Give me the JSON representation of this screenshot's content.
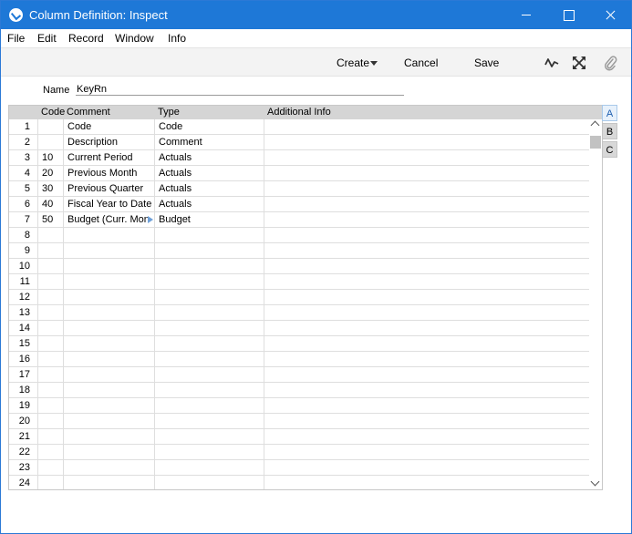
{
  "window": {
    "title": "Column Definition: Inspect"
  },
  "menu": [
    "File",
    "Edit",
    "Record",
    "Window",
    "Info"
  ],
  "toolbar": {
    "create": "Create",
    "cancel": "Cancel",
    "save": "Save"
  },
  "form": {
    "name_label": "Name",
    "name_value": "KeyRn"
  },
  "grid": {
    "headers": {
      "code": "Code",
      "comment": "Comment",
      "type": "Type",
      "info": "Additional Info"
    },
    "rows": [
      {
        "no": "1",
        "code": "",
        "comment": "Code",
        "type": "Code",
        "info": ""
      },
      {
        "no": "2",
        "code": "",
        "comment": "Description",
        "type": "Comment",
        "info": ""
      },
      {
        "no": "3",
        "code": "10",
        "comment": "Current Period",
        "type": "Actuals",
        "info": ""
      },
      {
        "no": "4",
        "code": "20",
        "comment": "Previous Month",
        "type": "Actuals",
        "info": ""
      },
      {
        "no": "5",
        "code": "30",
        "comment": "Previous Quarter",
        "type": "Actuals",
        "info": ""
      },
      {
        "no": "6",
        "code": "40",
        "comment": "Fiscal Year to Date",
        "type": "Actuals",
        "info": ""
      },
      {
        "no": "7",
        "code": "50",
        "comment": "Budget (Curr. Mon",
        "type": "Budget",
        "info": ""
      },
      {
        "no": "8",
        "code": "",
        "comment": "",
        "type": "",
        "info": ""
      },
      {
        "no": "9",
        "code": "",
        "comment": "",
        "type": "",
        "info": ""
      },
      {
        "no": "10",
        "code": "",
        "comment": "",
        "type": "",
        "info": ""
      },
      {
        "no": "11",
        "code": "",
        "comment": "",
        "type": "",
        "info": ""
      },
      {
        "no": "12",
        "code": "",
        "comment": "",
        "type": "",
        "info": ""
      },
      {
        "no": "13",
        "code": "",
        "comment": "",
        "type": "",
        "info": ""
      },
      {
        "no": "14",
        "code": "",
        "comment": "",
        "type": "",
        "info": ""
      },
      {
        "no": "15",
        "code": "",
        "comment": "",
        "type": "",
        "info": ""
      },
      {
        "no": "16",
        "code": "",
        "comment": "",
        "type": "",
        "info": ""
      },
      {
        "no": "17",
        "code": "",
        "comment": "",
        "type": "",
        "info": ""
      },
      {
        "no": "18",
        "code": "",
        "comment": "",
        "type": "",
        "info": ""
      },
      {
        "no": "19",
        "code": "",
        "comment": "",
        "type": "",
        "info": ""
      },
      {
        "no": "20",
        "code": "",
        "comment": "",
        "type": "",
        "info": ""
      },
      {
        "no": "21",
        "code": "",
        "comment": "",
        "type": "",
        "info": ""
      },
      {
        "no": "22",
        "code": "",
        "comment": "",
        "type": "",
        "info": ""
      },
      {
        "no": "23",
        "code": "",
        "comment": "",
        "type": "",
        "info": ""
      },
      {
        "no": "24",
        "code": "",
        "comment": "",
        "type": "",
        "info": ""
      }
    ]
  },
  "tabs": [
    "A",
    "B",
    "C"
  ],
  "icons": {
    "app": "checkmark-circle-icon",
    "pulse": "activity-pulse-icon",
    "expand": "expand-arrows-icon",
    "attach": "paperclip-icon"
  },
  "colors": {
    "titlebar": "#1e78d7",
    "active_tab": "#e7f1fb"
  }
}
